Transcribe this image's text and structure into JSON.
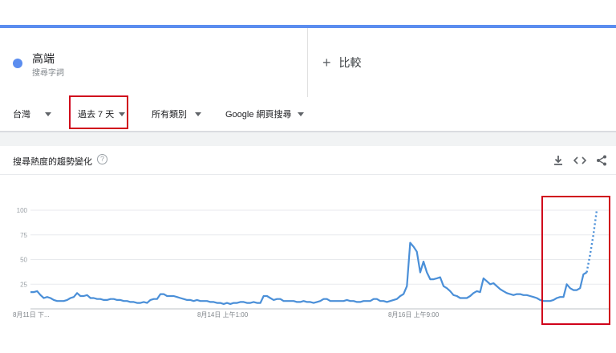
{
  "term": {
    "name": "高端",
    "sublabel": "搜尋字詞",
    "color": "#5b8def"
  },
  "compare": {
    "label": "比較"
  },
  "filters": {
    "region": "台灣",
    "time": "過去 7 天",
    "category": "所有類別",
    "source": "Google 網頁搜尋"
  },
  "card": {
    "title": "搜尋熱度的趨勢變化",
    "help": "?"
  },
  "icons": [
    "download-icon",
    "embed-icon",
    "share-icon"
  ],
  "chart_data": {
    "type": "line",
    "y_ticks": [
      "100",
      "75",
      "50",
      "25"
    ],
    "ylim": [
      0,
      100
    ],
    "x_labels": [
      "8月11日 下...",
      "8月14日 上午1:00",
      "8月16日 上午9:00"
    ],
    "grid": true,
    "series": [
      {
        "color": "#4a8fd8",
        "values": [
          17,
          17,
          18,
          14,
          11,
          12,
          11,
          9,
          8,
          8,
          8,
          9,
          11,
          12,
          16,
          13,
          13,
          14,
          11,
          11,
          10,
          10,
          9,
          9,
          10,
          10,
          9,
          9,
          8,
          8,
          7,
          7,
          6,
          6,
          7,
          6,
          9,
          10,
          10,
          15,
          15,
          13,
          13,
          13,
          12,
          11,
          10,
          9,
          9,
          8,
          9,
          8,
          8,
          8,
          7,
          7,
          6,
          6,
          5,
          6,
          5,
          6,
          6,
          7,
          7,
          6,
          6,
          7,
          6,
          6,
          13,
          13,
          11,
          9,
          10,
          10,
          8,
          8,
          8,
          8,
          7,
          7,
          8,
          7,
          7,
          6,
          7,
          8,
          10,
          10,
          8,
          8,
          8,
          8,
          8,
          9,
          8,
          8,
          7,
          7,
          8,
          8,
          8,
          10,
          10,
          8,
          8,
          7,
          8,
          9,
          10,
          13,
          15,
          23,
          67,
          63,
          58,
          37,
          48,
          37,
          30,
          30,
          31,
          32,
          23,
          21,
          18,
          14,
          13,
          11,
          11,
          11,
          13,
          16,
          18,
          17,
          31,
          28,
          25,
          26,
          23,
          20,
          18,
          16,
          15,
          14,
          15,
          15,
          14,
          14,
          13,
          12,
          11,
          9,
          8,
          8,
          8,
          9,
          11,
          12,
          12,
          25,
          21,
          19,
          19,
          21,
          35,
          37
        ],
        "dotted_tail": [
          37,
          55,
          75,
          100
        ]
      }
    ]
  }
}
